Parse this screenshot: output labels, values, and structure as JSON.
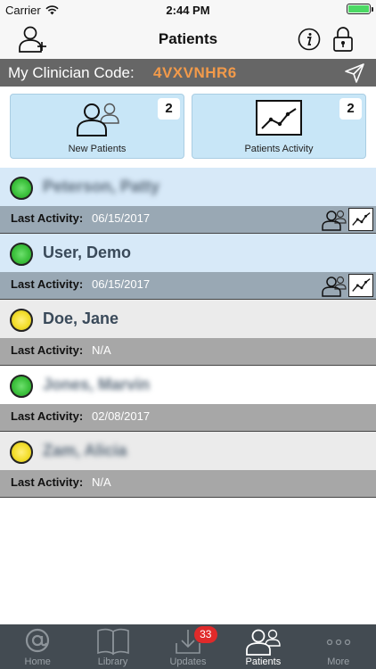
{
  "status_bar": {
    "carrier": "Carrier",
    "time": "2:44 PM"
  },
  "nav": {
    "title": "Patients"
  },
  "clinician": {
    "label": "My Clinician Code:",
    "code": "4VXVNHR6"
  },
  "cards": {
    "new_patients": {
      "label": "New Patients",
      "count": "2"
    },
    "patients_activity": {
      "label": "Patients Activity",
      "count": "2"
    }
  },
  "patients": [
    {
      "name": "Peterson, Patty",
      "status": "green",
      "activity_label": "Last Activity:",
      "activity_date": "06/15/2017"
    },
    {
      "name": "User, Demo",
      "status": "green",
      "activity_label": "Last Activity:",
      "activity_date": "06/15/2017"
    },
    {
      "name": "Doe, Jane",
      "status": "yellow",
      "activity_label": "Last Activity:",
      "activity_date": "N/A"
    },
    {
      "name": "Jones, Marvin",
      "status": "green",
      "activity_label": "Last Activity:",
      "activity_date": "02/08/2017"
    },
    {
      "name": "Zam, Alicia",
      "status": "yellow",
      "activity_label": "Last Activity:",
      "activity_date": "N/A"
    }
  ],
  "tabs": [
    {
      "label": "Home",
      "icon": "at-icon"
    },
    {
      "label": "Library",
      "icon": "book-icon"
    },
    {
      "label": "Updates",
      "icon": "download-icon",
      "badge": "33"
    },
    {
      "label": "Patients",
      "icon": "patients-icon",
      "active": true
    },
    {
      "label": "More",
      "icon": "more-icon"
    }
  ],
  "colors": {
    "code_accent": "#f29a4a",
    "card_background": "#c8e6f7",
    "status_green": "#3cc13c",
    "status_yellow": "#f3de2c",
    "tab_bar": "#434b52",
    "badge": "#e02a2a"
  }
}
